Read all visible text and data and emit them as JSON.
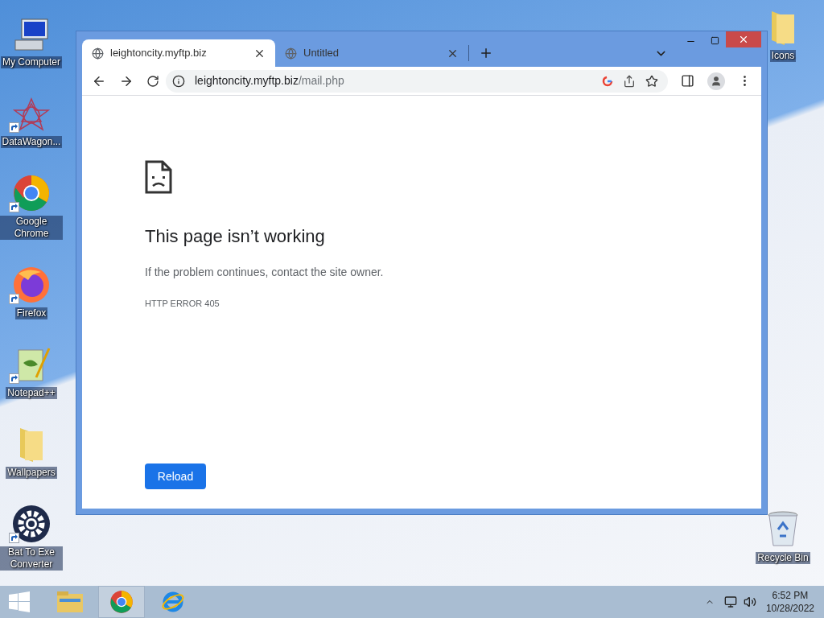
{
  "desktop_icons_left": [
    {
      "label": "My Computer",
      "kind": "computer",
      "shortcut": false
    },
    {
      "label": "DataWagon...",
      "kind": "star",
      "shortcut": true
    },
    {
      "label": "Google Chrome",
      "kind": "chrome",
      "shortcut": true
    },
    {
      "label": "Firefox",
      "kind": "firefox",
      "shortcut": true
    },
    {
      "label": "Notepad++",
      "kind": "notepad",
      "shortcut": true
    },
    {
      "label": "Wallpapers",
      "kind": "folder",
      "shortcut": false
    },
    {
      "label": "Bat To Exe Converter",
      "kind": "gear",
      "shortcut": true
    }
  ],
  "desktop_icons_right": [
    {
      "label": "Icons",
      "kind": "folder",
      "shortcut": false
    },
    {
      "label": "Recycle Bin",
      "kind": "bin",
      "shortcut": false
    }
  ],
  "browser": {
    "tabs": [
      {
        "title": "leightoncity.myftp.biz",
        "selected": true
      },
      {
        "title": "Untitled",
        "selected": false
      }
    ],
    "url": {
      "host": "leightoncity.myftp.biz",
      "path": "/mail.php"
    },
    "page": {
      "heading": "This page isn’t working",
      "message": "If the problem continues, contact the site owner.",
      "error_code": "HTTP ERROR 405",
      "button": "Reload"
    }
  },
  "taskbar": {
    "items": [
      {
        "kind": "explorer",
        "selected": false
      },
      {
        "kind": "chrome",
        "selected": true
      },
      {
        "kind": "ie",
        "selected": false
      }
    ],
    "time": "6:52 PM",
    "date": "10/28/2022"
  }
}
